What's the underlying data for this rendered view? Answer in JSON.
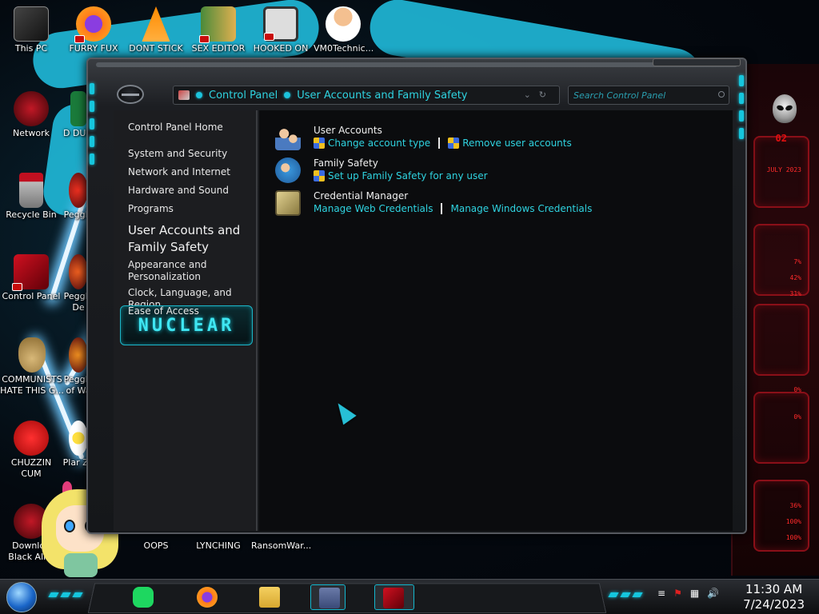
{
  "desktop": {
    "icons": [
      {
        "id": "this-pc",
        "label": "This PC"
      },
      {
        "id": "furry-fux",
        "label": "FURRY FUX"
      },
      {
        "id": "dont-stick",
        "label": "DONT STICK"
      },
      {
        "id": "sex-editor",
        "label": "SEX EDITOR"
      },
      {
        "id": "hooked-on",
        "label": "HOOKED ON"
      },
      {
        "id": "vm0technic",
        "label": "VM0Technic..."
      },
      {
        "id": "network",
        "label": "Network"
      },
      {
        "id": "d-dum",
        "label": "D DUM"
      },
      {
        "id": "recycle-bin",
        "label": "Recycle Bin"
      },
      {
        "id": "peggle",
        "label": "Peggle"
      },
      {
        "id": "control-panel",
        "label": "Control Panel"
      },
      {
        "id": "peggle-de",
        "label": "Peggle De"
      },
      {
        "id": "communists",
        "label": "COMMUNISTS HATE THIS G..."
      },
      {
        "id": "peggle-wa",
        "label": "Peggle of Wa"
      },
      {
        "id": "chuzzin-cum",
        "label": "CHUZZIN CUM"
      },
      {
        "id": "plants-zo",
        "label": "Plar Zo"
      },
      {
        "id": "download-black",
        "label": "Downloa Black Ali..."
      },
      {
        "id": "oops",
        "label": "OOPS"
      },
      {
        "id": "lynching",
        "label": "LYNCHING"
      },
      {
        "id": "ransomware",
        "label": "RansomWar..."
      }
    ]
  },
  "widget": {
    "date_text": "JULY 2023",
    "num_text": "02",
    "pcts": [
      "7%",
      "42%",
      "31%",
      "0%",
      "0%",
      "36%",
      "100%",
      "100%"
    ]
  },
  "window": {
    "breadcrumb": [
      "Control Panel",
      "User Accounts and Family Safety"
    ],
    "search_placeholder": "Search Control Panel",
    "nav": {
      "home": "Control Panel Home",
      "items": [
        "System and Security",
        "Network and Internet",
        "Hardware and Sound",
        "Programs",
        "User Accounts and Family Safety",
        "Appearance and Personalization",
        "Clock, Language, and Region",
        "Ease of Access"
      ]
    },
    "nuclear_badge": "NUCLEAR",
    "categories": [
      {
        "title": "User Accounts",
        "links": [
          "Change account type",
          "Remove user accounts"
        ]
      },
      {
        "title": "Family Safety",
        "links": [
          "Set up Family Safety for any user"
        ]
      },
      {
        "title": "Credential Manager",
        "links": [
          "Manage Web Credentials",
          "Manage Windows Credentials"
        ]
      }
    ]
  },
  "taskbar": {
    "time": "11:30 AM",
    "date": "7/24/2023"
  }
}
